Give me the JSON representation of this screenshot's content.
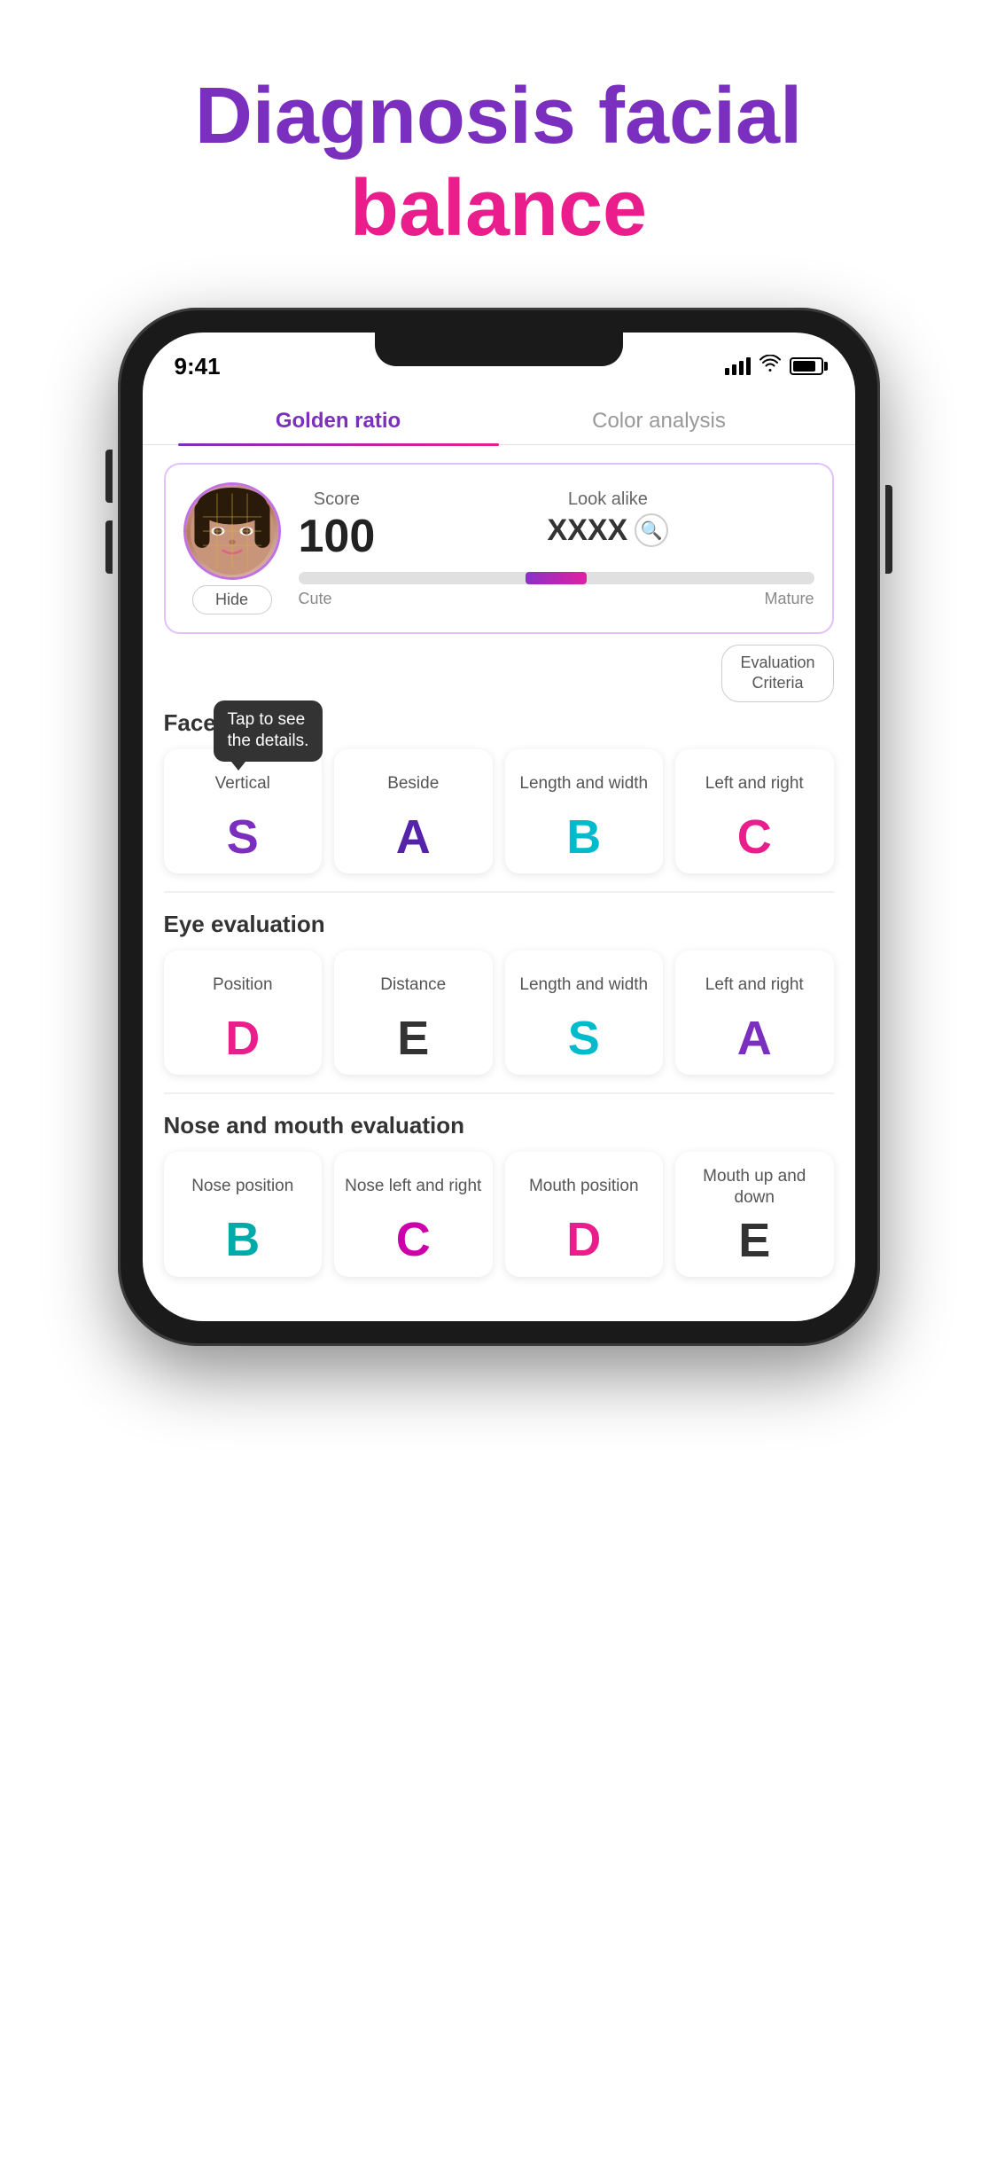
{
  "page": {
    "title_part1": "Diagnosis facial",
    "title_part2": "balance"
  },
  "status_bar": {
    "time": "9:41"
  },
  "tabs": [
    {
      "id": "golden-ratio",
      "label": "Golden ratio",
      "active": true
    },
    {
      "id": "color-analysis",
      "label": "Color analysis",
      "active": false
    }
  ],
  "score_card": {
    "score_label": "Score",
    "score_value": "100",
    "look_alike_label": "Look alike",
    "look_alike_value": "XXXX",
    "hide_button": "Hide",
    "progress_label_left": "Cute",
    "progress_label_right": "Mature"
  },
  "eval_criteria_button": "Evaluation\nCriteria",
  "tooltip": "Tap to see\nthe details.",
  "face_evaluation": {
    "label": "Face eva...",
    "cards": [
      {
        "label": "Vertical",
        "grade": "S",
        "grade_class": "grade-purple"
      },
      {
        "label": "Beside",
        "grade": "A",
        "grade_class": "grade-dark-purple"
      },
      {
        "label": "Length and width",
        "grade": "B",
        "grade_class": "grade-cyan"
      },
      {
        "label": "Left and right",
        "grade": "C",
        "grade_class": "grade-pink"
      }
    ]
  },
  "eye_evaluation": {
    "label": "Eye evaluation",
    "cards": [
      {
        "label": "Position",
        "grade": "D",
        "grade_class": "grade-pink"
      },
      {
        "label": "Distance",
        "grade": "E",
        "grade_class": "grade-dark"
      },
      {
        "label": "Length and width",
        "grade": "S",
        "grade_class": "grade-cyan"
      },
      {
        "label": "Left and right",
        "grade": "A",
        "grade_class": "grade-purple"
      }
    ]
  },
  "nose_mouth_evaluation": {
    "label": "Nose and mouth evaluation",
    "cards": [
      {
        "label": "Nose position",
        "grade": "B",
        "grade_class": "grade-teal"
      },
      {
        "label": "Nose left and right",
        "grade": "C",
        "grade_class": "grade-magenta"
      },
      {
        "label": "Mouth position",
        "grade": "D",
        "grade_class": "grade-pink"
      },
      {
        "label": "Mouth up and down",
        "grade": "E",
        "grade_class": "grade-dark"
      }
    ]
  }
}
